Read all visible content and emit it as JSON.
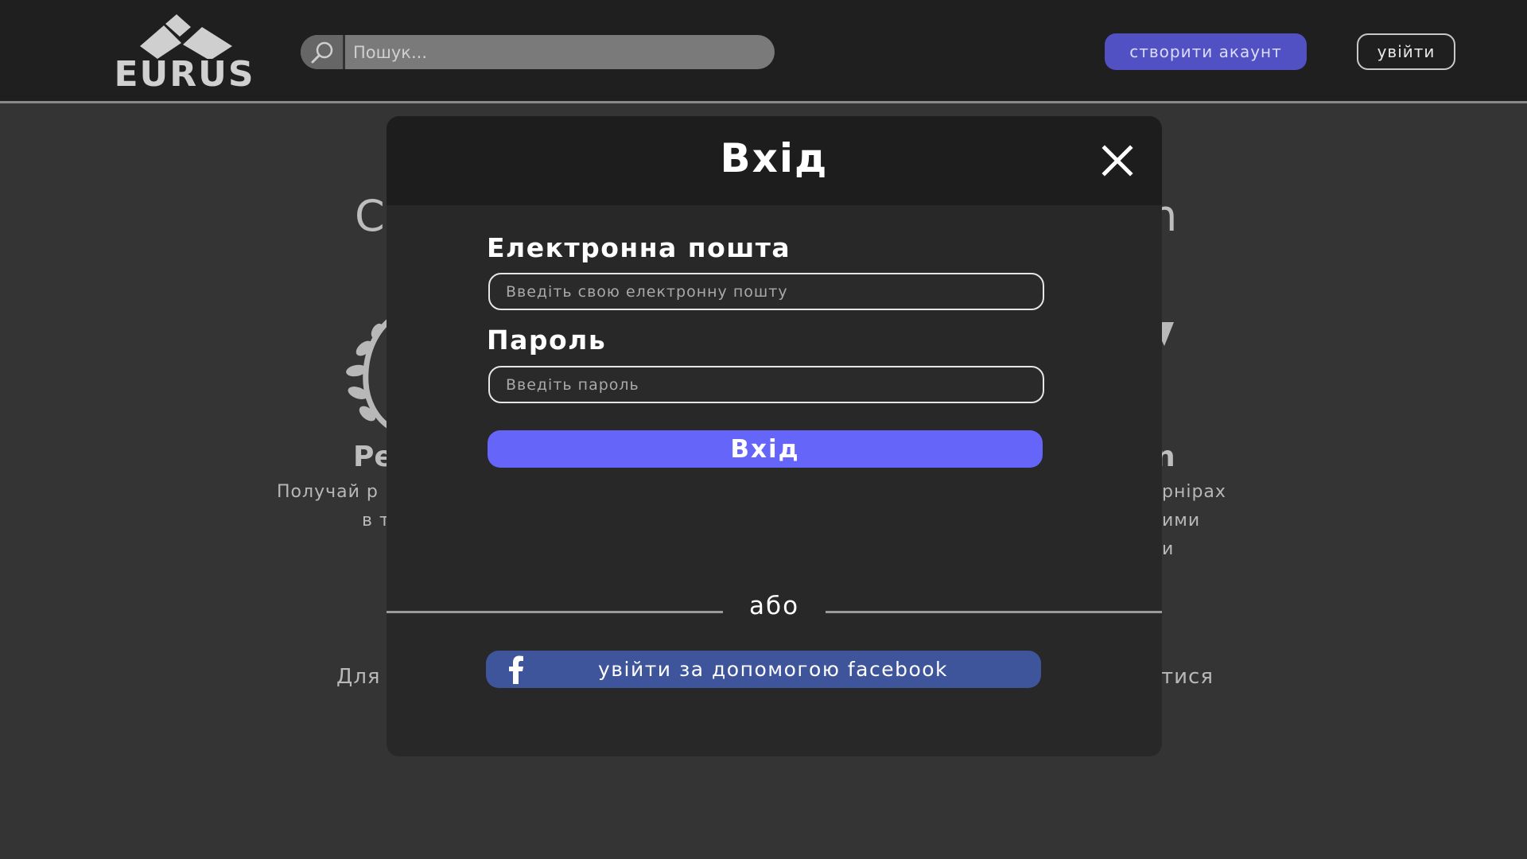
{
  "header": {
    "logo_text": "EURUS",
    "search_placeholder": "Пошук...",
    "create_account_label": "створити акаунт",
    "login_label": "увійти"
  },
  "background": {
    "heading_left": "C",
    "heading_right": "n",
    "sub_left": "Pe",
    "sub_right": "n",
    "line1_left": "Получай р",
    "line2_left": "в т",
    "line1_right": "рнірах",
    "line2_right": "ими",
    "line3_right": "и",
    "bottom_left": "Для",
    "bottom_right": "тися"
  },
  "modal": {
    "title": "Вхід",
    "email_label": "Електронна пошта",
    "email_placeholder": "Введіть свою електронну пошту",
    "password_label": "Пароль",
    "password_placeholder": "Введіть пароль",
    "submit_label": "Вхід",
    "divider_text": "або",
    "facebook_label": "увійти за допомогою facebook"
  },
  "colors": {
    "accent": "#6665fa",
    "create_button": "#5251c4",
    "facebook": "#3e549b",
    "header_bg": "#1f1f1f",
    "modal_bg": "#282828",
    "page_bg": "#343434"
  }
}
